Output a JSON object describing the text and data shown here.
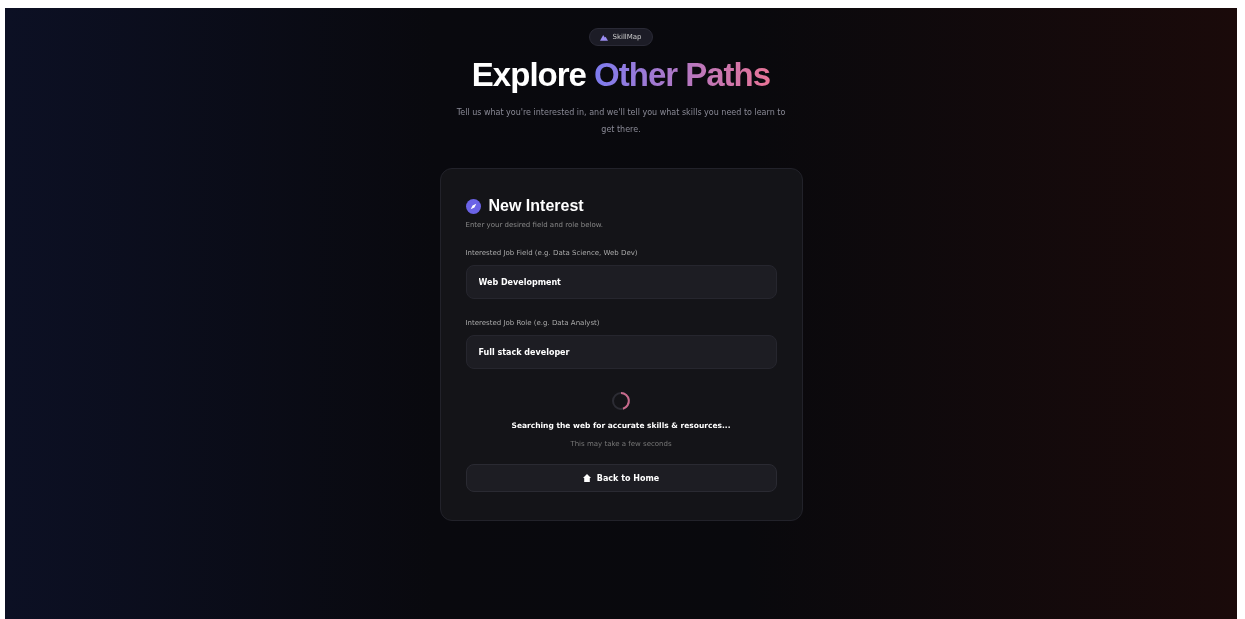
{
  "badge": {
    "label": "SkillMap"
  },
  "heading": {
    "lead": "Explore",
    "highlight": "Other Paths"
  },
  "subtitle": "Tell us what you're interested in, and we'll tell you what skills you need to learn to get there.",
  "card": {
    "title": "New Interest",
    "description": "Enter your desired field and role below.",
    "fields": [
      {
        "label": "Interested Job Field (e.g. Data Science, Web Dev)",
        "value": "Web Development"
      },
      {
        "label": "Interested Job Role (e.g. Data Analyst)",
        "value": "Full stack developer"
      }
    ],
    "status": {
      "message": "Searching the web for accurate skills & resources...",
      "note": "This may take a few seconds"
    },
    "back_button": "Back to Home"
  }
}
